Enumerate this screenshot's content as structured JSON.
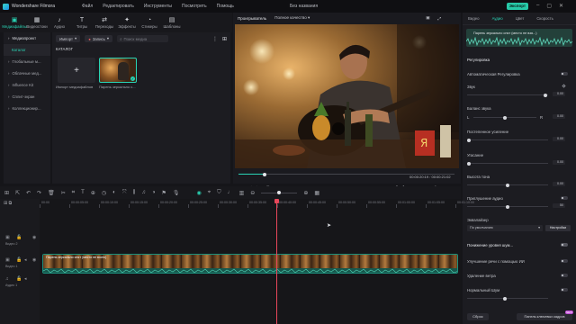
{
  "titlebar": {
    "app_name": "Wondershare Filmora",
    "menus": [
      "Файл",
      "Редактировать",
      "Инструменты",
      "Посмотреть",
      "Помощь"
    ],
    "doc_title": "Без названия",
    "export_label": "Экспорт"
  },
  "tooltabs": [
    {
      "label": "Медиафайлы",
      "icon": "folder-icon",
      "active": true
    },
    {
      "label": "Видеостоки",
      "icon": "stock-icon",
      "active": false
    },
    {
      "label": "Аудио",
      "icon": "music-icon",
      "active": false
    },
    {
      "label": "Титры",
      "icon": "text-icon",
      "active": false
    },
    {
      "label": "Переходы",
      "icon": "transition-icon",
      "active": false
    },
    {
      "label": "Эффекты",
      "icon": "effects-icon",
      "active": false
    },
    {
      "label": "Стикеры",
      "icon": "sticker-icon",
      "active": false
    },
    {
      "label": "Шаблоны",
      "icon": "template-icon",
      "active": false
    }
  ],
  "library": {
    "side_items": [
      "Медиапроект",
      "Каталог",
      "Глобальные м...",
      "Облачные мед...",
      "Influence Kit",
      "Сплит-экран",
      "Коллекционир..."
    ],
    "import_label": "Импорт",
    "record_label": "Запись",
    "search_placeholder": "Поиск медиа",
    "catalog_title": "КАТАЛОГ",
    "import_tile_label": "Импорт медиафайлов",
    "clip_tile_label": "Парень зеркально с..."
  },
  "preview": {
    "tab_player": "Проигрыватель",
    "quality": "Полное качество",
    "time_current": "00:00:20:19",
    "time_total": "00:00:21:02",
    "progress": 0.12
  },
  "right_panel": {
    "tabs": [
      "Видео",
      "Аудио",
      "Цвет",
      "Скорость"
    ],
    "active_tab": "Аудио",
    "clip_name": "Парень зеркально снят (место не взя...)",
    "section_adjust": "Регулировка",
    "auto_adjust": "Автоматическая Регулировка",
    "sound_label": "Звук",
    "sound_value": "0.00",
    "balance_label": "Баланс звука",
    "balance_left": "L",
    "balance_right": "R",
    "balance_value": "0.00",
    "fadein_label": "Постепенное усиление",
    "fadein_value": "0.00",
    "fadeout_label": "Угасание",
    "fadeout_value": "0.00",
    "pitch_label": "Высота тона",
    "pitch_value": "0.00",
    "ducking_label": "Приглушение аудио",
    "ducking_value": "50",
    "eq_label": "Эквалайзер",
    "eq_value": "По умолчанию",
    "eq_settings": "Настройки",
    "section_noise": "Понижение уровня шум...",
    "ai_voice": "Улучшение речи с помощью ИИ",
    "wind": "Удаление ветра",
    "normal_noise": "Нормальный Шум",
    "reset_label": "Сброс",
    "keyframe_label": "Панель ключевых кадров",
    "keyframe_badge": "NEW"
  },
  "timeline": {
    "ruler_labels": [
      "00:00",
      "00:00:05:00",
      "00:00:10:00",
      "00:00:15:00",
      "00:00:20:00",
      "00:00:25:00",
      "00:00:30:00",
      "00:00:35:00",
      "00:00:40:00",
      "00:00:45:00",
      "00:00:50:00",
      "00:00:55:00",
      "00:01:00:00",
      "00:01:05:00",
      "00:01:10:00"
    ],
    "tracks": [
      "Видео 2",
      "Видео 1",
      "Аудио 1"
    ],
    "clip_label": "Парень зеркально снят (место не взято)"
  }
}
